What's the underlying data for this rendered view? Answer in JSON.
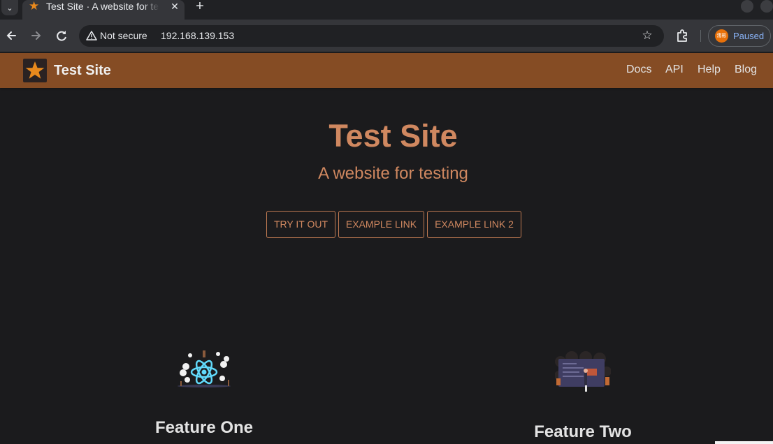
{
  "browser": {
    "tab_title": "Test Site · A website for testing",
    "security_label": "Not secure",
    "url": "192.168.139.153",
    "profile_label": "Paused",
    "profile_avatar_text": "濡彬"
  },
  "site": {
    "brand": "Test Site",
    "nav": [
      "Docs",
      "API",
      "Help",
      "Blog"
    ],
    "accent": "#d08860",
    "navbar_color": "#854c24"
  },
  "hero": {
    "title": "Test Site",
    "subtitle": "A website for testing",
    "buttons": [
      "TRY IT OUT",
      "EXAMPLE LINK",
      "EXAMPLE LINK 2"
    ]
  },
  "features": [
    {
      "title": "Feature One",
      "icon": "react-atom-illustration"
    },
    {
      "title": "Feature Two",
      "icon": "presentation-board-illustration"
    }
  ]
}
